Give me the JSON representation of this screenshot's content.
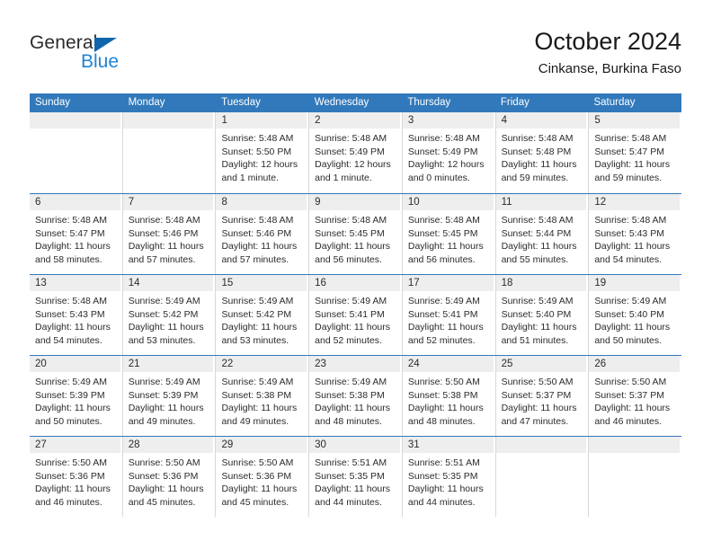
{
  "brand": {
    "name_part1": "General",
    "name_part2": "Blue",
    "accent_color": "#1f84d6",
    "triangle_color": "#1165ad",
    "logo_icon": "triangle-icon"
  },
  "header": {
    "title": "October 2024",
    "subtitle": "Cinkanse, Burkina Faso"
  },
  "calendar": {
    "header_bg": "#3279bb",
    "header_text_color": "#ffffff",
    "weekdays": [
      "Sunday",
      "Monday",
      "Tuesday",
      "Wednesday",
      "Thursday",
      "Friday",
      "Saturday"
    ],
    "weeks": [
      [
        {
          "date": "",
          "empty": true
        },
        {
          "date": "",
          "empty": true
        },
        {
          "date": "1",
          "sunrise": "Sunrise: 5:48 AM",
          "sunset": "Sunset: 5:50 PM",
          "daylight": "Daylight: 12 hours and 1 minute."
        },
        {
          "date": "2",
          "sunrise": "Sunrise: 5:48 AM",
          "sunset": "Sunset: 5:49 PM",
          "daylight": "Daylight: 12 hours and 1 minute."
        },
        {
          "date": "3",
          "sunrise": "Sunrise: 5:48 AM",
          "sunset": "Sunset: 5:49 PM",
          "daylight": "Daylight: 12 hours and 0 minutes."
        },
        {
          "date": "4",
          "sunrise": "Sunrise: 5:48 AM",
          "sunset": "Sunset: 5:48 PM",
          "daylight": "Daylight: 11 hours and 59 minutes."
        },
        {
          "date": "5",
          "sunrise": "Sunrise: 5:48 AM",
          "sunset": "Sunset: 5:47 PM",
          "daylight": "Daylight: 11 hours and 59 minutes."
        }
      ],
      [
        {
          "date": "6",
          "sunrise": "Sunrise: 5:48 AM",
          "sunset": "Sunset: 5:47 PM",
          "daylight": "Daylight: 11 hours and 58 minutes."
        },
        {
          "date": "7",
          "sunrise": "Sunrise: 5:48 AM",
          "sunset": "Sunset: 5:46 PM",
          "daylight": "Daylight: 11 hours and 57 minutes."
        },
        {
          "date": "8",
          "sunrise": "Sunrise: 5:48 AM",
          "sunset": "Sunset: 5:46 PM",
          "daylight": "Daylight: 11 hours and 57 minutes."
        },
        {
          "date": "9",
          "sunrise": "Sunrise: 5:48 AM",
          "sunset": "Sunset: 5:45 PM",
          "daylight": "Daylight: 11 hours and 56 minutes."
        },
        {
          "date": "10",
          "sunrise": "Sunrise: 5:48 AM",
          "sunset": "Sunset: 5:45 PM",
          "daylight": "Daylight: 11 hours and 56 minutes."
        },
        {
          "date": "11",
          "sunrise": "Sunrise: 5:48 AM",
          "sunset": "Sunset: 5:44 PM",
          "daylight": "Daylight: 11 hours and 55 minutes."
        },
        {
          "date": "12",
          "sunrise": "Sunrise: 5:48 AM",
          "sunset": "Sunset: 5:43 PM",
          "daylight": "Daylight: 11 hours and 54 minutes."
        }
      ],
      [
        {
          "date": "13",
          "sunrise": "Sunrise: 5:48 AM",
          "sunset": "Sunset: 5:43 PM",
          "daylight": "Daylight: 11 hours and 54 minutes."
        },
        {
          "date": "14",
          "sunrise": "Sunrise: 5:49 AM",
          "sunset": "Sunset: 5:42 PM",
          "daylight": "Daylight: 11 hours and 53 minutes."
        },
        {
          "date": "15",
          "sunrise": "Sunrise: 5:49 AM",
          "sunset": "Sunset: 5:42 PM",
          "daylight": "Daylight: 11 hours and 53 minutes."
        },
        {
          "date": "16",
          "sunrise": "Sunrise: 5:49 AM",
          "sunset": "Sunset: 5:41 PM",
          "daylight": "Daylight: 11 hours and 52 minutes."
        },
        {
          "date": "17",
          "sunrise": "Sunrise: 5:49 AM",
          "sunset": "Sunset: 5:41 PM",
          "daylight": "Daylight: 11 hours and 52 minutes."
        },
        {
          "date": "18",
          "sunrise": "Sunrise: 5:49 AM",
          "sunset": "Sunset: 5:40 PM",
          "daylight": "Daylight: 11 hours and 51 minutes."
        },
        {
          "date": "19",
          "sunrise": "Sunrise: 5:49 AM",
          "sunset": "Sunset: 5:40 PM",
          "daylight": "Daylight: 11 hours and 50 minutes."
        }
      ],
      [
        {
          "date": "20",
          "sunrise": "Sunrise: 5:49 AM",
          "sunset": "Sunset: 5:39 PM",
          "daylight": "Daylight: 11 hours and 50 minutes."
        },
        {
          "date": "21",
          "sunrise": "Sunrise: 5:49 AM",
          "sunset": "Sunset: 5:39 PM",
          "daylight": "Daylight: 11 hours and 49 minutes."
        },
        {
          "date": "22",
          "sunrise": "Sunrise: 5:49 AM",
          "sunset": "Sunset: 5:38 PM",
          "daylight": "Daylight: 11 hours and 49 minutes."
        },
        {
          "date": "23",
          "sunrise": "Sunrise: 5:49 AM",
          "sunset": "Sunset: 5:38 PM",
          "daylight": "Daylight: 11 hours and 48 minutes."
        },
        {
          "date": "24",
          "sunrise": "Sunrise: 5:50 AM",
          "sunset": "Sunset: 5:38 PM",
          "daylight": "Daylight: 11 hours and 48 minutes."
        },
        {
          "date": "25",
          "sunrise": "Sunrise: 5:50 AM",
          "sunset": "Sunset: 5:37 PM",
          "daylight": "Daylight: 11 hours and 47 minutes."
        },
        {
          "date": "26",
          "sunrise": "Sunrise: 5:50 AM",
          "sunset": "Sunset: 5:37 PM",
          "daylight": "Daylight: 11 hours and 46 minutes."
        }
      ],
      [
        {
          "date": "27",
          "sunrise": "Sunrise: 5:50 AM",
          "sunset": "Sunset: 5:36 PM",
          "daylight": "Daylight: 11 hours and 46 minutes."
        },
        {
          "date": "28",
          "sunrise": "Sunrise: 5:50 AM",
          "sunset": "Sunset: 5:36 PM",
          "daylight": "Daylight: 11 hours and 45 minutes."
        },
        {
          "date": "29",
          "sunrise": "Sunrise: 5:50 AM",
          "sunset": "Sunset: 5:36 PM",
          "daylight": "Daylight: 11 hours and 45 minutes."
        },
        {
          "date": "30",
          "sunrise": "Sunrise: 5:51 AM",
          "sunset": "Sunset: 5:35 PM",
          "daylight": "Daylight: 11 hours and 44 minutes."
        },
        {
          "date": "31",
          "sunrise": "Sunrise: 5:51 AM",
          "sunset": "Sunset: 5:35 PM",
          "daylight": "Daylight: 11 hours and 44 minutes."
        },
        {
          "date": "",
          "empty": true
        },
        {
          "date": "",
          "empty": true
        }
      ]
    ]
  }
}
